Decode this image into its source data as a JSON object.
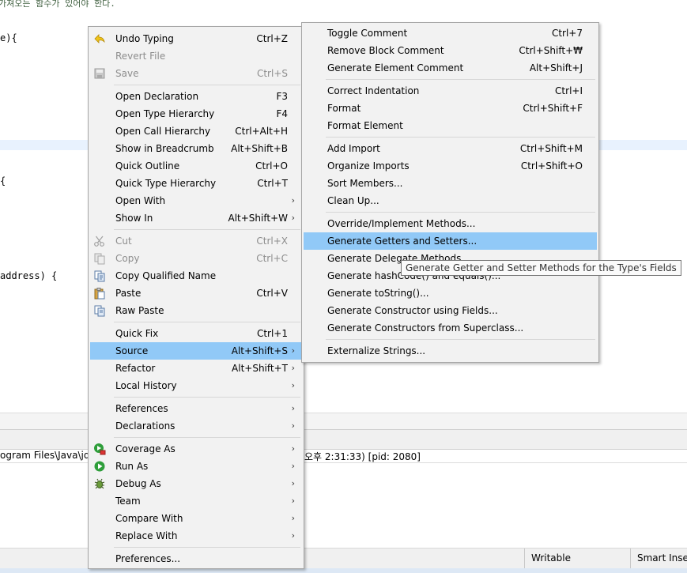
{
  "editor": {
    "comment_line": "가져오는 함수가 있어야 한다.",
    "line_method_sig": "e){",
    "line_brace": " {",
    "line_address": "address) {"
  },
  "console": {
    "title_left": "ogram Files\\Java\\jdl",
    "title_right": "오후 2:31:33) [pid: 2080]"
  },
  "status_bar": {
    "writable": "Writable",
    "insert_mode": "Smart Insert"
  },
  "context_menu": {
    "items": [
      {
        "label": "Undo Typing",
        "shortcut": "Ctrl+Z",
        "icon": "undo-icon",
        "enabled": true
      },
      {
        "label": "Revert File",
        "shortcut": "",
        "enabled": false
      },
      {
        "label": "Save",
        "shortcut": "Ctrl+S",
        "icon": "save-icon",
        "enabled": false
      },
      {
        "label": "Open Declaration",
        "shortcut": "F3",
        "enabled": true
      },
      {
        "label": "Open Type Hierarchy",
        "shortcut": "F4",
        "enabled": true
      },
      {
        "label": "Open Call Hierarchy",
        "shortcut": "Ctrl+Alt+H",
        "enabled": true
      },
      {
        "label": "Show in Breadcrumb",
        "shortcut": "Alt+Shift+B",
        "enabled": true
      },
      {
        "label": "Quick Outline",
        "shortcut": "Ctrl+O",
        "enabled": true
      },
      {
        "label": "Quick Type Hierarchy",
        "shortcut": "Ctrl+T",
        "enabled": true
      },
      {
        "label": "Open With",
        "shortcut": "",
        "submenu": true,
        "enabled": true
      },
      {
        "label": "Show In",
        "shortcut": "Alt+Shift+W",
        "submenu": true,
        "enabled": true
      },
      {
        "label": "Cut",
        "shortcut": "Ctrl+X",
        "icon": "cut-icon",
        "enabled": false
      },
      {
        "label": "Copy",
        "shortcut": "Ctrl+C",
        "icon": "copy-icon",
        "enabled": false
      },
      {
        "label": "Copy Qualified Name",
        "shortcut": "",
        "icon": "copy-qualified-name-icon",
        "enabled": true
      },
      {
        "label": "Paste",
        "shortcut": "Ctrl+V",
        "icon": "paste-icon",
        "enabled": true
      },
      {
        "label": "Raw Paste",
        "shortcut": "",
        "icon": "raw-paste-icon",
        "enabled": true
      },
      {
        "label": "Quick Fix",
        "shortcut": "Ctrl+1",
        "enabled": true
      },
      {
        "label": "Source",
        "shortcut": "Alt+Shift+S",
        "submenu": true,
        "selected": true,
        "enabled": true
      },
      {
        "label": "Refactor",
        "shortcut": "Alt+Shift+T",
        "submenu": true,
        "enabled": true
      },
      {
        "label": "Local History",
        "shortcut": "",
        "submenu": true,
        "enabled": true
      },
      {
        "label": "References",
        "shortcut": "",
        "submenu": true,
        "enabled": true
      },
      {
        "label": "Declarations",
        "shortcut": "",
        "submenu": true,
        "enabled": true
      },
      {
        "label": "Coverage As",
        "shortcut": "",
        "submenu": true,
        "icon": "coverage-icon",
        "enabled": true
      },
      {
        "label": "Run As",
        "shortcut": "",
        "submenu": true,
        "icon": "run-icon",
        "enabled": true
      },
      {
        "label": "Debug As",
        "shortcut": "",
        "submenu": true,
        "icon": "debug-icon",
        "enabled": true
      },
      {
        "label": "Team",
        "shortcut": "",
        "submenu": true,
        "enabled": true
      },
      {
        "label": "Compare With",
        "shortcut": "",
        "submenu": true,
        "enabled": true
      },
      {
        "label": "Replace With",
        "shortcut": "",
        "submenu": true,
        "enabled": true
      },
      {
        "label": "Preferences...",
        "shortcut": "",
        "enabled": true
      }
    ]
  },
  "source_menu": {
    "items": [
      {
        "label": "Toggle Comment",
        "shortcut": "Ctrl+7"
      },
      {
        "label": "Remove Block Comment",
        "shortcut": "Ctrl+Shift+₩"
      },
      {
        "label": "Generate Element Comment",
        "shortcut": "Alt+Shift+J"
      },
      {
        "label": "Correct Indentation",
        "shortcut": "Ctrl+I"
      },
      {
        "label": "Format",
        "shortcut": "Ctrl+Shift+F"
      },
      {
        "label": "Format Element",
        "shortcut": ""
      },
      {
        "label": "Add Import",
        "shortcut": "Ctrl+Shift+M"
      },
      {
        "label": "Organize Imports",
        "shortcut": "Ctrl+Shift+O"
      },
      {
        "label": "Sort Members...",
        "shortcut": ""
      },
      {
        "label": "Clean Up...",
        "shortcut": ""
      },
      {
        "label": "Override/Implement Methods...",
        "shortcut": ""
      },
      {
        "label": "Generate Getters and Setters...",
        "shortcut": "",
        "selected": true
      },
      {
        "label": "Generate Delegate Methods...",
        "shortcut": ""
      },
      {
        "label": "Generate hashCode() and equals()...",
        "shortcut": ""
      },
      {
        "label": "Generate toString()...",
        "shortcut": ""
      },
      {
        "label": "Generate Constructor using Fields...",
        "shortcut": ""
      },
      {
        "label": "Generate Constructors from Superclass...",
        "shortcut": ""
      },
      {
        "label": "Externalize Strings...",
        "shortcut": ""
      }
    ]
  },
  "tooltip": {
    "text": "Generate Getter and Setter Methods for the Type's Fields"
  },
  "colors": {
    "selection": "#91c9f7",
    "menu_bg": "#f2f2f2",
    "disabled_text": "#8d8d8d",
    "run_green": "#2e9e3a"
  }
}
